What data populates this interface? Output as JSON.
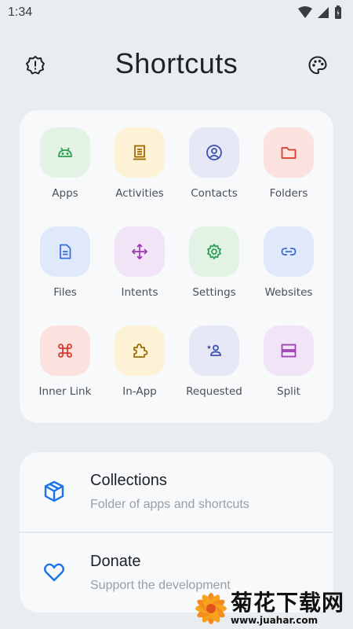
{
  "status_bar": {
    "time": "1:34"
  },
  "header": {
    "title": "Shortcuts"
  },
  "grid": [
    {
      "label": "Apps",
      "icon": "android-icon",
      "bg": "#e2f3e6",
      "fg": "#2e9e52"
    },
    {
      "label": "Activities",
      "icon": "activity-list-icon",
      "bg": "#fdf1d6",
      "fg": "#a26a00"
    },
    {
      "label": "Contacts",
      "icon": "contact-icon",
      "bg": "#e6e8f6",
      "fg": "#3f51b5"
    },
    {
      "label": "Folders",
      "icon": "folder-icon",
      "bg": "#fbe2df",
      "fg": "#d93a2b"
    },
    {
      "label": "Files",
      "icon": "file-icon",
      "bg": "#dfe9fb",
      "fg": "#3c6fd4"
    },
    {
      "label": "Intents",
      "icon": "move-arrows-icon",
      "bg": "#f1e4f6",
      "fg": "#9c3bb5"
    },
    {
      "label": "Settings",
      "icon": "gear-icon",
      "bg": "#e2f3e6",
      "fg": "#2e9e52"
    },
    {
      "label": "Websites",
      "icon": "link-icon",
      "bg": "#dfe9fb",
      "fg": "#3c6fd4"
    },
    {
      "label": "Inner Link",
      "icon": "command-icon",
      "bg": "#fbe2df",
      "fg": "#d93a2b"
    },
    {
      "label": "In-App",
      "icon": "puzzle-icon",
      "bg": "#fdf1d6",
      "fg": "#a26a00"
    },
    {
      "label": "Requested",
      "icon": "person-star-icon",
      "bg": "#e6e8f6",
      "fg": "#3f51b5"
    },
    {
      "label": "Split",
      "icon": "split-icon",
      "bg": "#f1e4f6",
      "fg": "#9c3bb5"
    }
  ],
  "list": [
    {
      "title": "Collections",
      "subtitle": "Folder of apps and shortcuts",
      "icon": "box-icon",
      "color": "#1a73e8"
    },
    {
      "title": "Donate",
      "subtitle": "Support the development",
      "icon": "heart-icon",
      "color": "#1a73e8"
    }
  ],
  "watermark": {
    "main": "菊花下载网",
    "url": "www.juahar.com"
  }
}
